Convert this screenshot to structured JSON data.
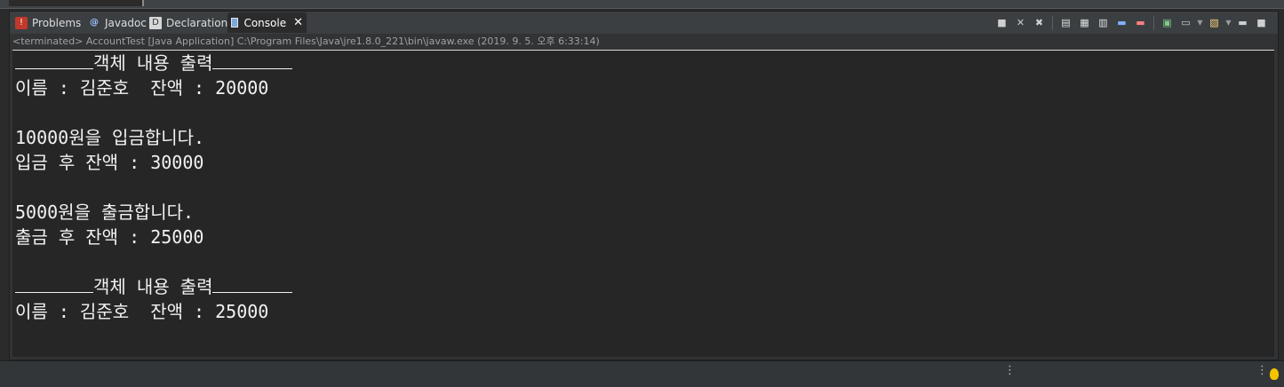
{
  "tabs": [
    {
      "label": "Problems",
      "icon": "problems-icon",
      "active": false
    },
    {
      "label": "Javadoc",
      "icon": "javadoc-icon",
      "active": false
    },
    {
      "label": "Declaration",
      "icon": "declaration-icon",
      "active": false
    },
    {
      "label": "Console",
      "icon": "console-icon",
      "active": true
    }
  ],
  "toolbar_icons": [
    "terminate-icon",
    "remove-launch-icon",
    "remove-all-terminated-icon",
    "scroll-lock-icon",
    "show-standard-output-icon",
    "show-standard-error-icon",
    "pin-console-icon",
    "word-wrap-icon",
    "display-selected-console-icon",
    "open-console-icon",
    "minimize-icon",
    "maximize-icon"
  ],
  "status": "<terminated> AccountTest [Java Application] C:\\Program Files\\Java\\jre1.8.0_221\\bin\\javaw.exe (2019. 9. 5. 오후 6:33:14)",
  "console": {
    "header1": "객체 내용 출력",
    "line1": "이름 : 김준호  잔액 : 20000",
    "line2": "10000원을 입금합니다.",
    "line3": "입금 후 잔액 : 30000",
    "line4": "5000원을 출금합니다.",
    "line5": "출금 후 잔액 : 25000",
    "header2": "객체 내용 출력",
    "line6": "이름 : 김준호  잔액 : 25000"
  },
  "colors": {
    "background": "#262626",
    "text": "#f2f2f2",
    "accent": "#f4c400"
  }
}
